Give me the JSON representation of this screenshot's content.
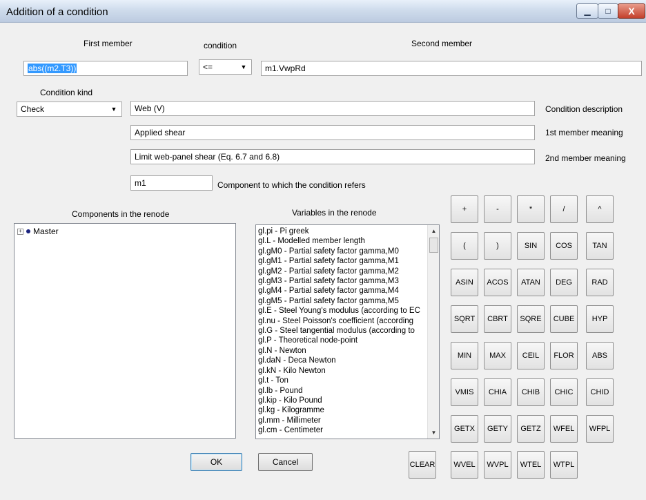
{
  "window": {
    "title": "Addition of a condition",
    "minimize_glyph": "▁",
    "maximize_glyph": "□",
    "close_glyph": "X"
  },
  "first_member": {
    "label": "First member",
    "value": "abs((m2.T3))"
  },
  "condition": {
    "label": "condition",
    "value": "<="
  },
  "second_member": {
    "label": "Second member",
    "value": "m1.VwpRd"
  },
  "condition_kind": {
    "label": "Condition kind",
    "value": "Check"
  },
  "condition_description": {
    "value": "Web (V)",
    "label": "Condition description"
  },
  "first_meaning": {
    "value": "Applied shear",
    "label": "1st  member meaning"
  },
  "second_meaning": {
    "value": "Limit web-panel shear (Eq. 6.7 and 6.8)",
    "label": "2nd member meaning"
  },
  "component": {
    "value": "m1",
    "label": "Component to which the condition refers"
  },
  "components_panel": {
    "label": "Components in the renode",
    "tree_items": [
      {
        "label": "Master",
        "expander": "+"
      }
    ]
  },
  "variables_panel": {
    "label": "Variables in the renode",
    "items": [
      "gl.pi  -  Pi greek",
      "gl.L  -  Modelled member length",
      "gl.gM0  -  Partial safety factor gamma,M0",
      "gl.gM1  -  Partial safety factor gamma,M1",
      "gl.gM2  -  Partial safety factor gamma,M2",
      "gl.gM3  -  Partial safety factor gamma,M3",
      "gl.gM4  -  Partial safety factor gamma,M4",
      "gl.gM5  -  Partial safety factor gamma,M5",
      "gl.E  -  Steel Young's modulus (according to EC",
      "gl.nu  -  Steel Poisson's coefficient (according",
      "gl.G  -  Steel tangential modulus (according to",
      "gl.P  -  Theoretical node-point",
      "gl.N  -  Newton",
      "gl.daN  -  Deca Newton",
      "gl.kN  -  Kilo Newton",
      "gl.t  -  Ton",
      "gl.lb  -  Pound",
      "gl.kip  -  Kilo Pound",
      "gl.kg  -  Kilogramme",
      "gl.mm  -  Millimeter",
      "gl.cm  -  Centimeter"
    ]
  },
  "keypad": [
    [
      "+",
      "-",
      "*",
      "/",
      "^"
    ],
    [
      "(",
      ")",
      "SIN",
      "COS",
      "TAN"
    ],
    [
      "ASIN",
      "ACOS",
      "ATAN",
      "DEG",
      "RAD"
    ],
    [
      "SQRT",
      "CBRT",
      "SQRE",
      "CUBE",
      "HYP"
    ],
    [
      "MIN",
      "MAX",
      "CEIL",
      "FLOR",
      "ABS"
    ],
    [
      "VMIS",
      "CHIA",
      "CHIB",
      "CHIC",
      "CHID"
    ],
    [
      "GETX",
      "GETY",
      "GETZ",
      "WFEL",
      "WFPL"
    ],
    [
      "WVEL",
      "WVPL",
      "WTEL",
      "WTPL"
    ]
  ],
  "buttons": {
    "ok": "OK",
    "cancel": "Cancel",
    "clear": "CLEAR"
  }
}
